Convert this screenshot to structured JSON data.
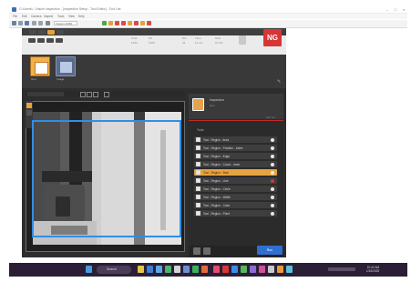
{
  "window": {
    "title": "C:\\Users\\...\\Vision Inspection - [Inspection Setup - Tool Editor] - Tool List",
    "min": "–",
    "max": "□",
    "close": "×"
  },
  "menu": [
    "File",
    "Edit",
    "Camera",
    "Inspect",
    "Tools",
    "View",
    "Help"
  ],
  "toolbar": {
    "zoom_value": "Inspect 100%"
  },
  "status": {
    "result_badge": "NG",
    "labels": [
      "Total",
      "OK",
      "NG",
      "Time",
      "Rate"
    ],
    "values": [
      "1234",
      "1200",
      "34",
      "12 ms",
      "97.2%"
    ]
  },
  "thumbnails": [
    {
      "label": "Tool"
    },
    {
      "label": "Image"
    }
  ],
  "panel": {
    "title": "Inspection",
    "subtitle": "Tool",
    "right_label": "100 ms",
    "list_header": "Tools",
    "rows": [
      {
        "label": "Tool - Region - Area",
        "checked": true,
        "selected": false,
        "flag": "ok"
      },
      {
        "label": "Tool - Region - Position - Index",
        "checked": true,
        "selected": false,
        "flag": "ok"
      },
      {
        "label": "Tool - Region - Edge",
        "checked": true,
        "selected": false,
        "flag": "ok"
      },
      {
        "label": "Tool - Region - Count - Inner",
        "checked": true,
        "selected": false,
        "flag": "ok"
      },
      {
        "label": "Tool - Region - Blob",
        "checked": true,
        "selected": true,
        "flag": "ok"
      },
      {
        "label": "Tool - Region - Line",
        "checked": true,
        "selected": false,
        "flag": "ng"
      },
      {
        "label": "Tool - Region - Circle",
        "checked": true,
        "selected": false,
        "flag": "ok"
      },
      {
        "label": "Tool - Region - Width",
        "checked": true,
        "selected": false,
        "flag": "ok"
      },
      {
        "label": "Tool - Region - Color",
        "checked": true,
        "selected": false,
        "flag": "ok"
      },
      {
        "label": "Tool - Region - Point",
        "checked": true,
        "selected": false,
        "flag": "ok"
      }
    ],
    "run_label": "Run"
  },
  "taskbar": {
    "search_placeholder": "Search",
    "time": "10:42 AM",
    "date": "1/15/2025"
  },
  "colors": {
    "ng_red": "#d63636",
    "accent_orange": "#e7a33e",
    "roi_blue": "#2f8ee8",
    "dark_bg": "#2d2d2d"
  }
}
